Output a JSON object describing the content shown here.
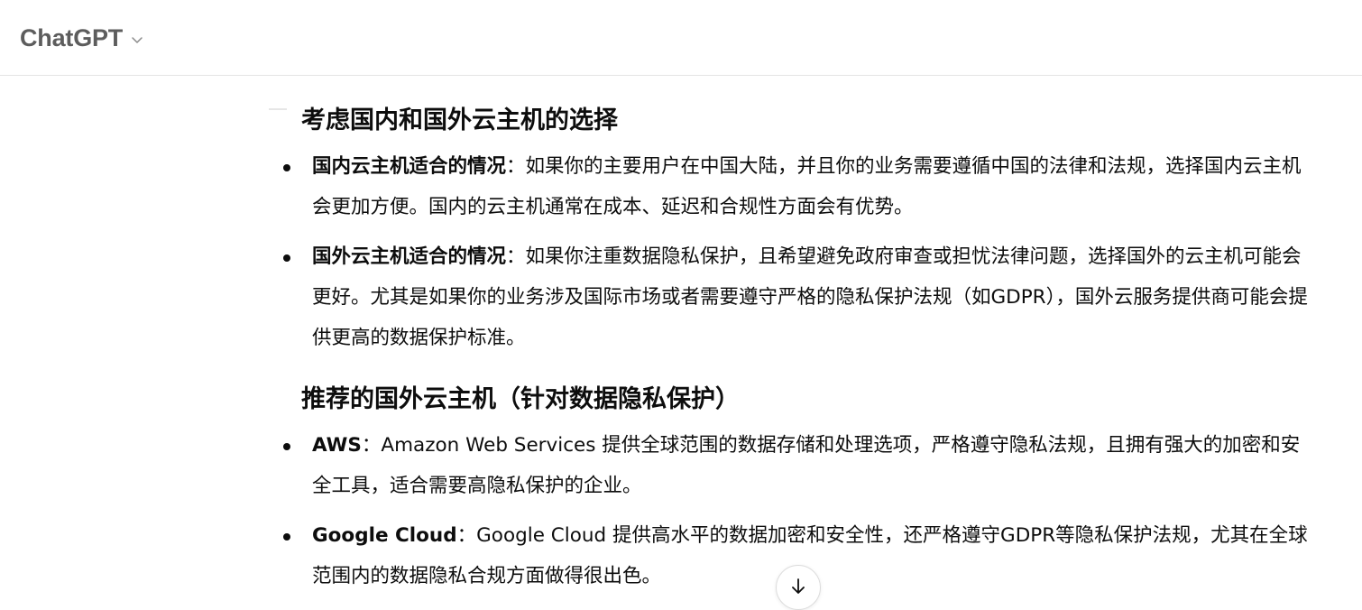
{
  "header": {
    "model_name": "ChatGPT",
    "chevron_icon": "chevron-down-icon"
  },
  "content": {
    "sections": [
      {
        "heading": "考虑国内和国外云主机的选择",
        "items": [
          {
            "bold": "国内云主机适合的情况",
            "text": "：如果你的主要用户在中国大陆，并且你的业务需要遵循中国的法律和法规，选择国内云主机会更加方便。国内的云主机通常在成本、延迟和合规性方面会有优势。"
          },
          {
            "bold": "国外云主机适合的情况",
            "text": "：如果你注重数据隐私保护，且希望避免政府审查或担忧法律问题，选择国外的云主机可能会更好。尤其是如果你的业务涉及国际市场或者需要遵守严格的隐私保护法规（如GDPR），国外云服务提供商可能会提供更高的数据保护标准。"
          }
        ]
      },
      {
        "heading": "推荐的国外云主机（针对数据隐私保护）",
        "items": [
          {
            "bold": "AWS",
            "text": "：Amazon Web Services 提供全球范围的数据存储和处理选项，严格遵守隐私法规，且拥有强大的加密和安全工具，适合需要高隐私保护的企业。"
          },
          {
            "bold": "Google Cloud",
            "text": "：Google Cloud 提供高水平的数据加密和安全性，还严格遵守GDPR等隐私保护法规，尤其在全球范围内的数据隐私合规方面做得很出色。"
          }
        ]
      }
    ]
  },
  "scroll_button": {
    "icon": "arrow-down-icon"
  }
}
